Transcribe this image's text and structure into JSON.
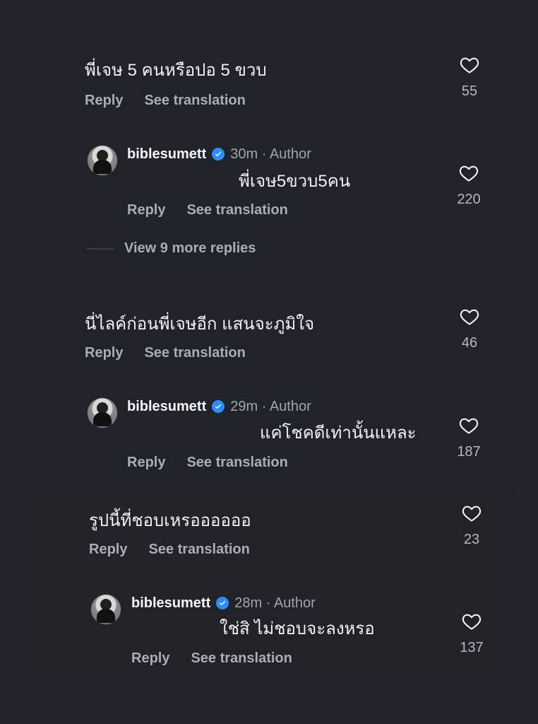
{
  "comments": [
    {
      "text": "พี่เจษ 5 คนหรือปอ 5 ขวบ",
      "actions": {
        "reply": "Reply",
        "translate": "See translation"
      },
      "likes": "55"
    },
    {
      "author": "biblesumett",
      "time": "30m",
      "author_label": "· Author",
      "text": "พี่เจษ5ขวบ5คน",
      "actions": {
        "reply": "Reply",
        "translate": "See translation"
      },
      "likes": "220"
    },
    {
      "more_replies": "View 9 more replies"
    },
    {
      "text": "นี่ไลค์ก่อนพี่เจษอีก แสนจะภูมิใจ",
      "actions": {
        "reply": "Reply",
        "translate": "See translation"
      },
      "likes": "46"
    },
    {
      "author": "biblesumett",
      "time": "29m",
      "author_label": "· Author",
      "text": "แค่โชคดีเท่านั้นแหละ",
      "actions": {
        "reply": "Reply",
        "translate": "See translation"
      },
      "likes": "187"
    },
    {
      "text": "รูปนี้ที่ชอบเหรออออออ",
      "actions": {
        "reply": "Reply",
        "translate": "See translation"
      },
      "likes": "23"
    },
    {
      "author": "biblesumett",
      "time": "28m",
      "author_label": "· Author",
      "text": "ใช่สิ ไม่ชอบจะลงหรอ",
      "actions": {
        "reply": "Reply",
        "translate": "See translation"
      },
      "likes": "137"
    }
  ],
  "icons": {
    "heart": "heart-icon",
    "verified": "verified-badge-icon",
    "avatar": "avatar"
  },
  "colors": {
    "background": "#21232a",
    "text": "#f2f2f4",
    "muted": "#a9adb7",
    "verified": "#2a8dff"
  }
}
